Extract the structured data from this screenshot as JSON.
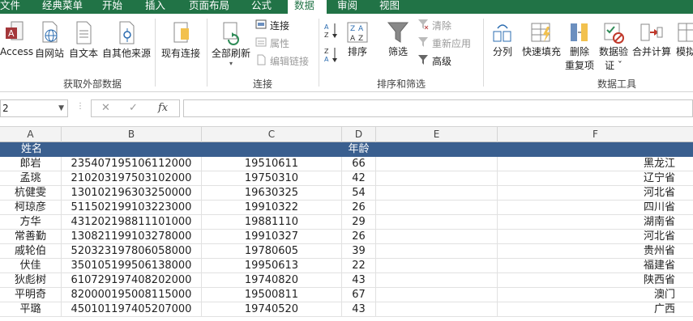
{
  "tabs": {
    "file": "文件",
    "classic": "经典菜单",
    "home": "开始",
    "insert": "插入",
    "layout": "页面布局",
    "formula": "公式",
    "data": "数据",
    "review": "审阅",
    "view": "视图"
  },
  "ribbon": {
    "external": {
      "access": "Access",
      "web": "自网站",
      "text": "自文本",
      "other": "自其他来源",
      "existing": "现有连接",
      "label": "获取外部数据"
    },
    "connections": {
      "refresh_all": "全部刷新",
      "connections": "连接",
      "properties": "属性",
      "edit_links": "编辑链接",
      "label": "连接"
    },
    "sort_filter": {
      "sort": "排序",
      "filter": "筛选",
      "clear": "清除",
      "reapply": "重新应用",
      "advanced": "高级",
      "label": "排序和筛选"
    },
    "data_tools": {
      "text_to_columns": "分列",
      "flash_fill": "快速填充",
      "remove_dup_1": "删除",
      "remove_dup_2": "重复项",
      "validation_1": "数据验",
      "validation_2": "证 ˇ",
      "consolidate": "合并计算",
      "whatif": "模拟",
      "label": "数据工具"
    }
  },
  "formula_bar": {
    "name_box": "2",
    "fx": "fx",
    "cancel": "✕",
    "enter": "✓",
    "formula": ""
  },
  "columns": [
    "A",
    "B",
    "C",
    "D",
    "E",
    "F"
  ],
  "table": {
    "header": {
      "name": "姓名",
      "age": "年龄"
    },
    "rows": [
      {
        "name": "郎岩",
        "id": "235407195106112000",
        "birth": "19510611",
        "age": "66",
        "province": "黑龙江"
      },
      {
        "name": "孟珧",
        "id": "210203197503102000",
        "birth": "19750310",
        "age": "42",
        "province": "辽宁省"
      },
      {
        "name": "杭健雯",
        "id": "130102196303250000",
        "birth": "19630325",
        "age": "54",
        "province": "河北省"
      },
      {
        "name": "柯琼彦",
        "id": "511502199103223000",
        "birth": "19910322",
        "age": "26",
        "province": "四川省"
      },
      {
        "name": "方华",
        "id": "431202198811101000",
        "birth": "19881110",
        "age": "29",
        "province": "湖南省"
      },
      {
        "name": "常善勤",
        "id": "130821199103278000",
        "birth": "19910327",
        "age": "26",
        "province": "河北省"
      },
      {
        "name": "戚轮伯",
        "id": "520323197806058000",
        "birth": "19780605",
        "age": "39",
        "province": "贵州省"
      },
      {
        "name": "伏佳",
        "id": "350105199506138000",
        "birth": "19950613",
        "age": "22",
        "province": "福建省"
      },
      {
        "name": "狄彪树",
        "id": "610729197408202000",
        "birth": "19740820",
        "age": "43",
        "province": "陕西省"
      },
      {
        "name": "平明奇",
        "id": "820000195008115000",
        "birth": "19500811",
        "age": "67",
        "province": "澳门"
      },
      {
        "name": "平璐",
        "id": "450101197405207000",
        "birth": "19740520",
        "age": "43",
        "province": "广西"
      }
    ]
  },
  "colors": {
    "ribbon_green": "#217346",
    "header_blue": "#3a5f8f"
  }
}
